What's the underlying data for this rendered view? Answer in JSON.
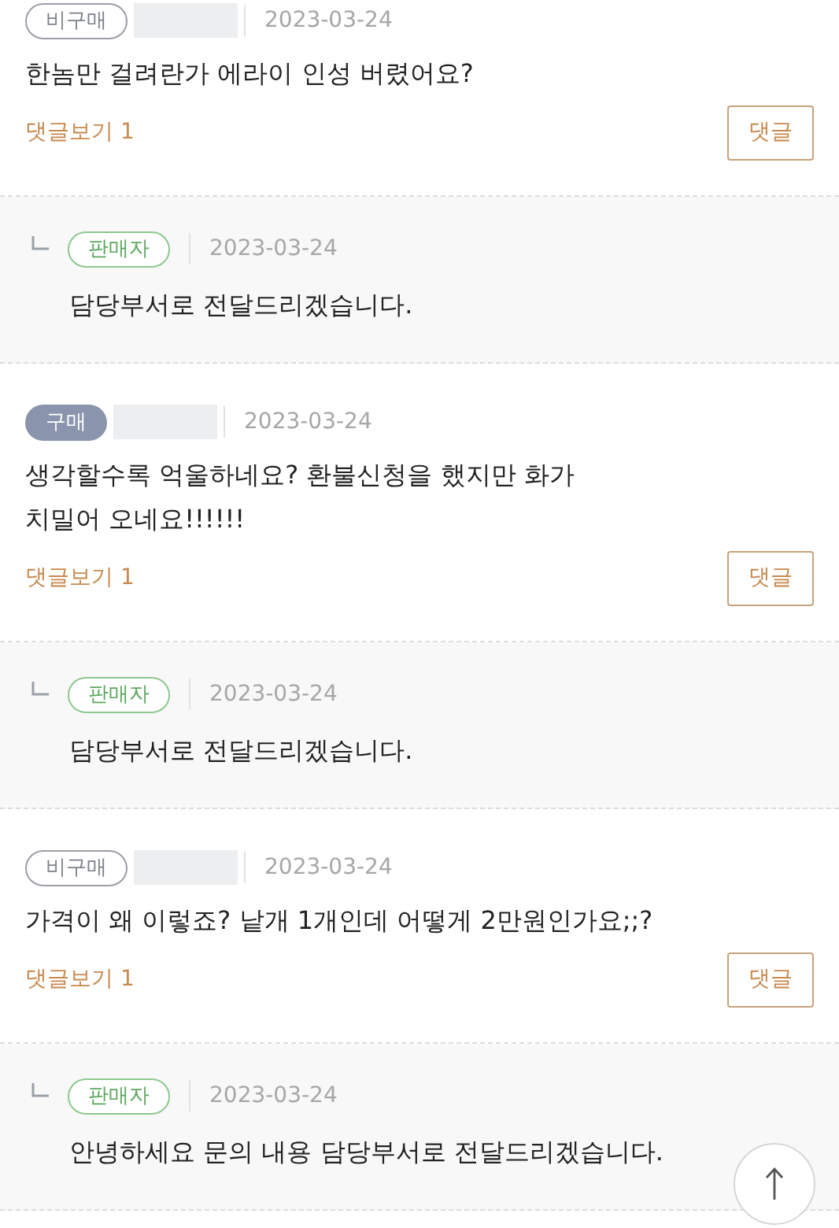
{
  "posts": [
    {
      "badge": {
        "label": "비구매",
        "kind": "non_buyer"
      },
      "date": "2023-03-24",
      "text": "한놈만 걸려란가 에라이 인성 버렸어요?",
      "view_replies": "댓글보기 1",
      "reply_button": "댓글",
      "reply": {
        "badge": {
          "label": "판매자",
          "kind": "seller"
        },
        "date": "2023-03-24",
        "text": "담당부서로 전달드리겠습니다."
      }
    },
    {
      "badge": {
        "label": "구매",
        "kind": "buyer"
      },
      "date": "2023-03-24",
      "text": "생각할수록 억울하네요? 환불신청을 했지만 화가 치밀어 오네요!!!!!!",
      "view_replies": "댓글보기 1",
      "reply_button": "댓글",
      "reply": {
        "badge": {
          "label": "판매자",
          "kind": "seller"
        },
        "date": "2023-03-24",
        "text": "담당부서로 전달드리겠습니다."
      }
    },
    {
      "badge": {
        "label": "비구매",
        "kind": "non_buyer"
      },
      "date": "2023-03-24",
      "text": "가격이 왜 이렇죠? 낱개 1개인데 어떻게 2만원인가요;;?",
      "view_replies": "댓글보기 1",
      "reply_button": "댓글",
      "reply": {
        "badge": {
          "label": "판매자",
          "kind": "seller"
        },
        "date": "2023-03-24",
        "text": "안녕하세요 문의 내용 담당부서로 전달드리겠습니다."
      }
    }
  ]
}
